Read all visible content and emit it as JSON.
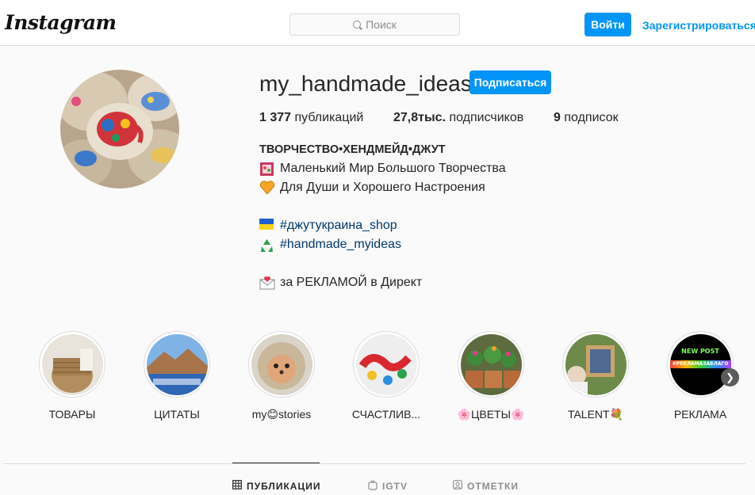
{
  "header": {
    "logo": "Instagram",
    "search_placeholder": "Поиск",
    "login_label": "Войти",
    "signup_label": "Зарегистрироваться"
  },
  "profile": {
    "username": "my_handmade_ideas",
    "follow_label": "Подписаться",
    "stats": {
      "posts_count": "1 377",
      "posts_label": "публикаций",
      "followers_count": "27,8тыс.",
      "followers_label": "подписчиков",
      "following_count": "9",
      "following_label": "подписок"
    },
    "bio": {
      "title": "ТВОРЧЕСТВО•ХЕНДМЕЙД•ДЖУТ",
      "line1": "Маленький Мир Большого Творчества",
      "line2": "Для Души и Хорошего Настроения",
      "tag1": "#джутукраина_shop",
      "tag2": "#handmade_myideas",
      "line3": "за РЕКЛАМОЙ в Директ"
    }
  },
  "highlights": [
    {
      "label": "ТОВАРЫ"
    },
    {
      "label": "ЦИТАТЫ"
    },
    {
      "label": "my😊stories"
    },
    {
      "label": "СЧАСТЛИВ..."
    },
    {
      "label": "🌸ЦВЕТЫ🌸"
    },
    {
      "label": "TALENT💐"
    },
    {
      "label": "РЕКЛАМА"
    }
  ],
  "highlight_image_texts": {
    "ad": "NEW POST",
    "ad_tag": "#РЕКЛАМАЗАБЛАГО"
  },
  "tabs": [
    {
      "label": "ПУБЛИКАЦИИ",
      "icon": "grid-icon",
      "active": true
    },
    {
      "label": "IGTV",
      "icon": "igtv-icon",
      "active": false
    },
    {
      "label": "ОТМЕТКИ",
      "icon": "tagged-icon",
      "active": false
    }
  ],
  "colors": {
    "accent": "#0095f6",
    "link": "#00376b",
    "text": "#262626",
    "muted": "#8e8e8e"
  }
}
